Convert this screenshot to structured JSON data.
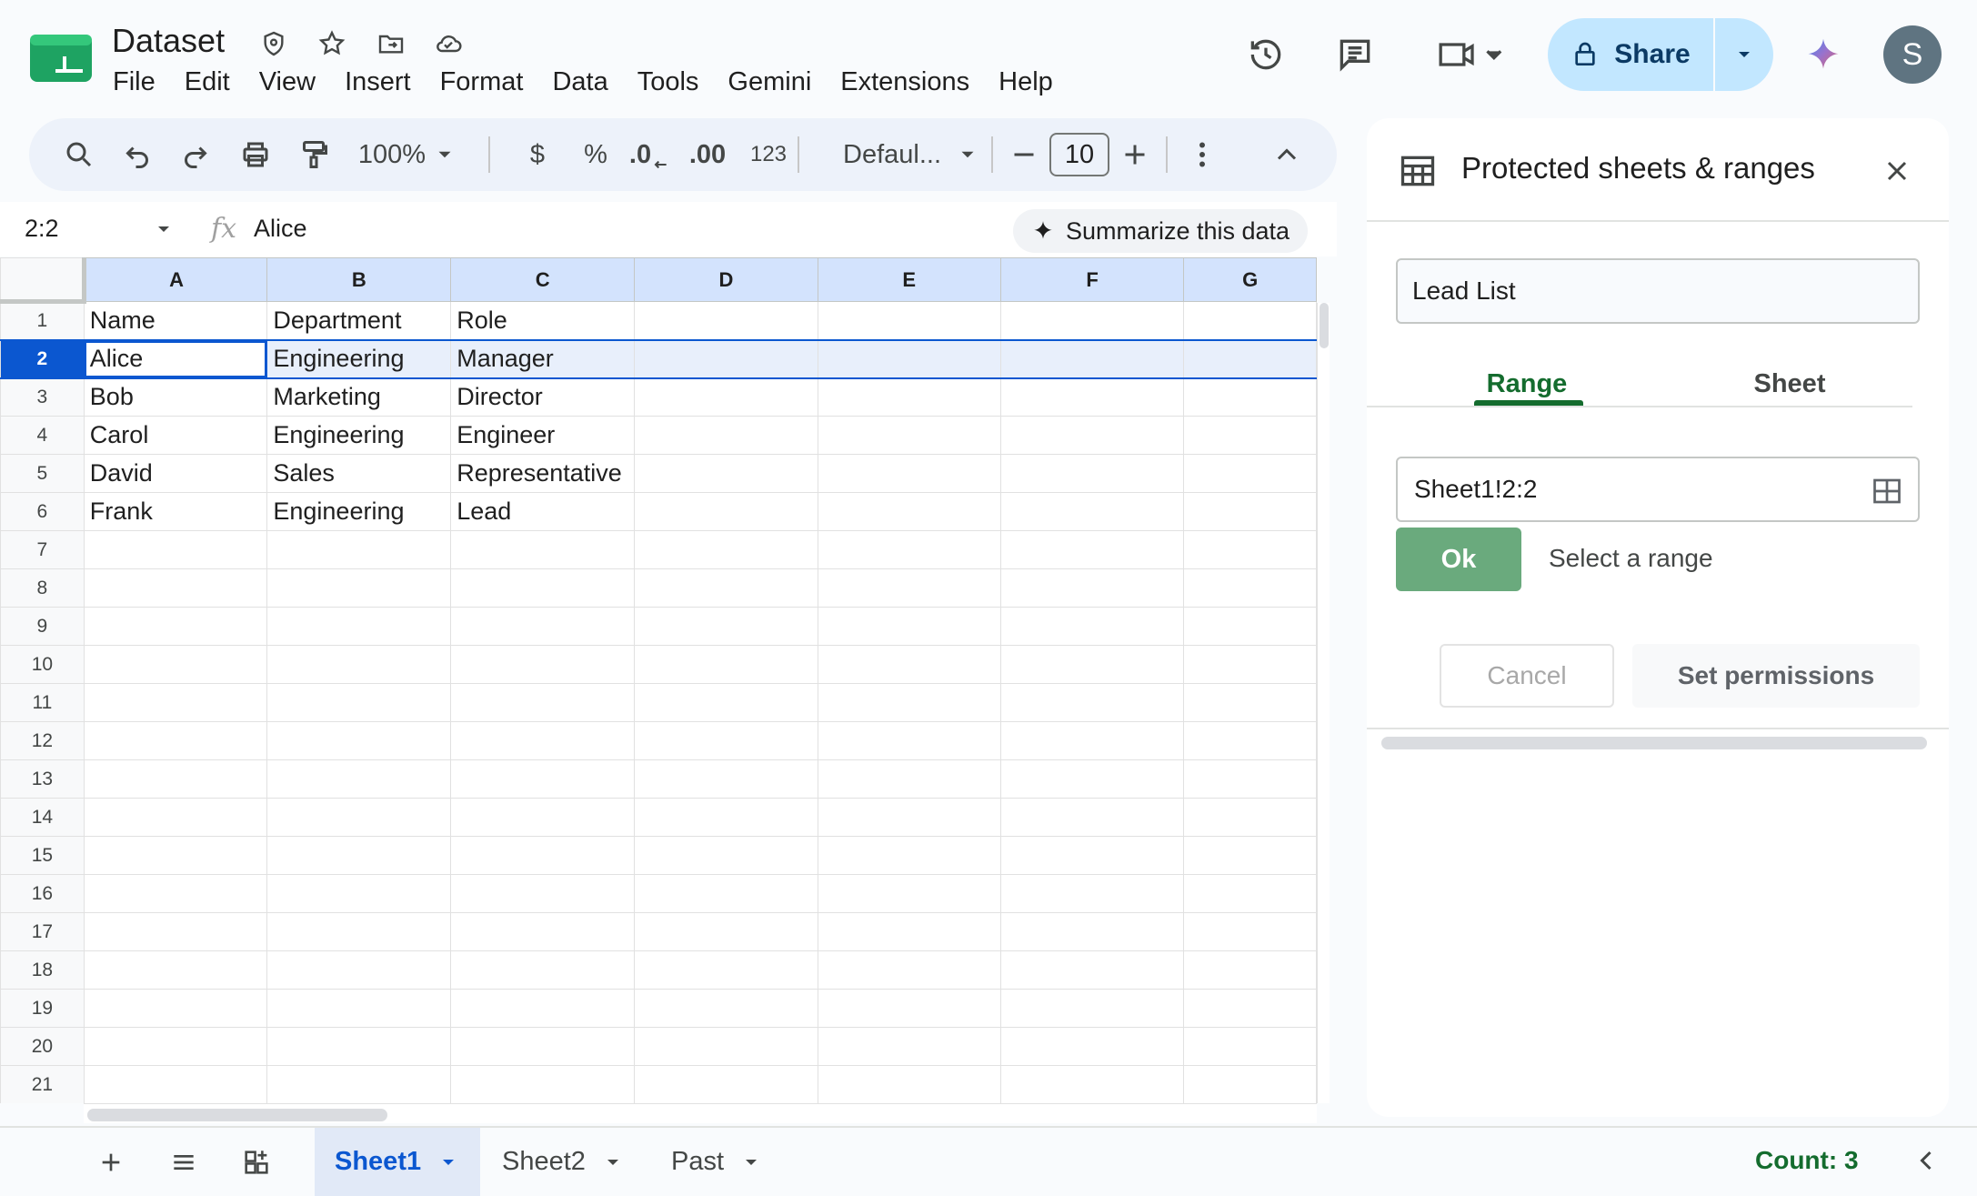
{
  "header": {
    "doc_title": "Dataset",
    "menus": [
      "File",
      "Edit",
      "View",
      "Insert",
      "Format",
      "Data",
      "Tools",
      "Gemini",
      "Extensions",
      "Help"
    ],
    "share_label": "Share",
    "avatar_initial": "S"
  },
  "toolbar": {
    "zoom": "100%",
    "currency_label": "$",
    "percent_label": "%",
    "decrease_decimal_label": ".0",
    "increase_decimal_label": ".00",
    "number_format_label": "123",
    "font_name": "Defaul...",
    "font_size": "10"
  },
  "formula_bar": {
    "name_box": "2:2",
    "fx_label": "fx",
    "value": "Alice",
    "summarize_label": "Summarize this data"
  },
  "grid": {
    "columns": [
      "A",
      "B",
      "C",
      "D",
      "E",
      "F",
      "G"
    ],
    "row_numbers": [
      "1",
      "2",
      "3",
      "4",
      "5",
      "6",
      "7",
      "8",
      "9",
      "10",
      "11",
      "12",
      "13",
      "14",
      "15",
      "16",
      "17",
      "18",
      "19",
      "20",
      "21"
    ],
    "rows": [
      [
        " Name",
        "  Department",
        "  Role"
      ],
      [
        " Alice",
        " Engineering",
        "  Manager"
      ],
      [
        " Bob",
        " Marketing",
        "  Director"
      ],
      [
        " Carol",
        " Engineering",
        "  Engineer"
      ],
      [
        " David",
        "   Sales",
        "Representative"
      ],
      [
        " Frank",
        " Engineering",
        "Lead"
      ]
    ],
    "selected_row": 2
  },
  "panel": {
    "title": "Protected sheets & ranges",
    "description_value": "Lead List",
    "tabs": [
      "Range",
      "Sheet"
    ],
    "range_value": "Sheet1!2:2",
    "ok_label": "Ok",
    "select_range_label": "Select a range",
    "cancel_label": "Cancel",
    "set_permissions_label": "Set permissions"
  },
  "bottom_bar": {
    "sheets": [
      "Sheet1",
      "Sheet2",
      "Past"
    ],
    "count": "Count: 3"
  },
  "colors": {
    "accent_blue": "#0b57d0",
    "accent_green": "#146c2e",
    "share_bg": "#c2e7ff",
    "ok_green": "#6aaa7d"
  }
}
